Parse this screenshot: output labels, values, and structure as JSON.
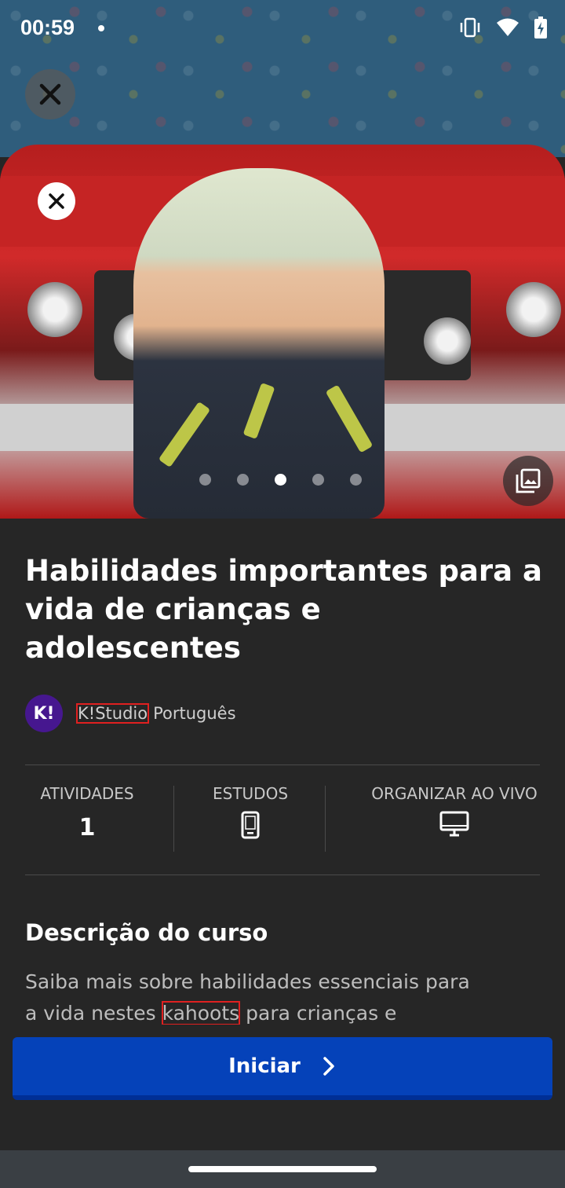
{
  "status_bar": {
    "time": "00:59"
  },
  "course": {
    "title": "Habilidades importantes para a vida de crianças e adolescentes",
    "author": {
      "avatar_text": "K!",
      "name": "K!Studio",
      "language": "Português"
    },
    "carousel": {
      "slides": 5,
      "active_index": 2
    }
  },
  "stats": {
    "activities": {
      "label": "ATIVIDADES",
      "value": "1"
    },
    "studies": {
      "label": "ESTUDOS",
      "icon": "smartphone-icon"
    },
    "live": {
      "label": "ORGANIZAR AO VIVO",
      "icon": "desktop-icon"
    }
  },
  "description": {
    "title": "Descrição do curso",
    "line1": "Saiba mais sobre habilidades essenciais para",
    "line2_prefix": "a vida nestes ",
    "line2_keyword": "kahoots",
    "line2_suffix": " para crianças e"
  },
  "actions": {
    "start_label": "Iniciar"
  },
  "colors": {
    "primary_button": "#0542b9",
    "avatar": "#46178f",
    "background": "#262626"
  }
}
